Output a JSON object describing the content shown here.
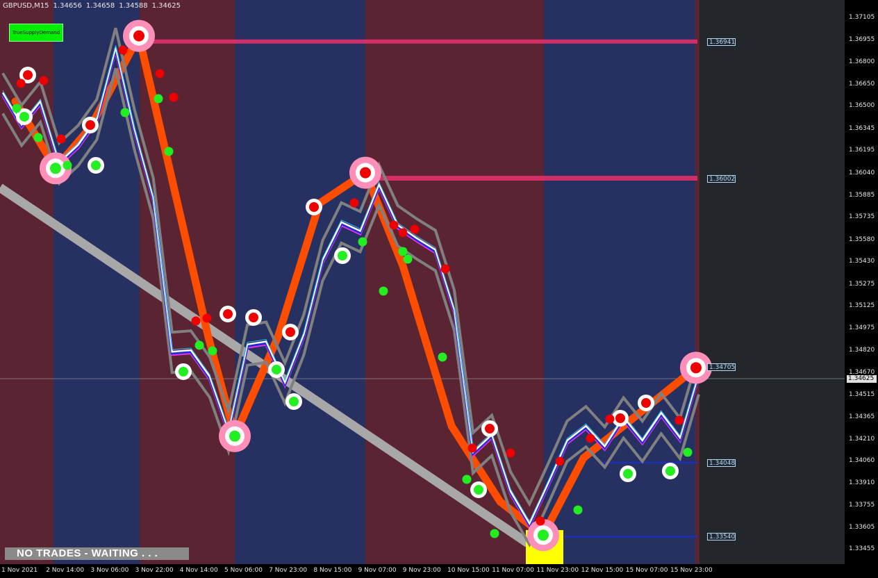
{
  "window": {
    "symbol": "GBPUSD,M15",
    "ohlc": [
      "1.34656",
      "1.34658",
      "1.34588",
      "1.34625"
    ]
  },
  "indicator_button": {
    "label": "TrueSupplyDemand"
  },
  "status_banner": {
    "text": "NO TRADES - WAITING . . ."
  },
  "price_axis": {
    "ticks": [
      "1.37105",
      "1.36955",
      "1.36800",
      "1.36650",
      "1.36500",
      "1.36345",
      "1.36195",
      "1.36040",
      "1.35885",
      "1.35735",
      "1.35580",
      "1.35430",
      "1.35275",
      "1.35125",
      "1.34975",
      "1.34820",
      "1.34670",
      "1.34515",
      "1.34365",
      "1.34210",
      "1.34060",
      "1.33910",
      "1.33755",
      "1.33605",
      "1.33455"
    ],
    "range": [
      1.3337,
      1.3715
    ]
  },
  "levels": [
    {
      "label": "1.36941",
      "value": 1.36941,
      "color": "#ff3f7f"
    },
    {
      "label": "1.36002",
      "value": 1.36002,
      "color": "#ff3f7f"
    },
    {
      "label": "1.34705",
      "value": 1.34705,
      "color": "#cccccc"
    },
    {
      "label": "1.34048",
      "value": 1.34048,
      "color": "#3333cc"
    },
    {
      "label": "1.33540",
      "value": 1.3354,
      "color": "#3333cc"
    }
  ],
  "current_price": {
    "label": "1.34625",
    "value": 1.34625
  },
  "time_axis": {
    "labels": [
      "1 Nov 2021",
      "2 Nov 14:00",
      "3 Nov 06:00",
      "3 Nov 22:00",
      "4 Nov 14:00",
      "5 Nov 06:00",
      "7 Nov 23:00",
      "8 Nov 15:00",
      "9 Nov 07:00",
      "9 Nov 23:00",
      "10 Nov 15:00",
      "11 Nov 07:00",
      "11 Nov 23:00",
      "12 Nov 15:00",
      "15 Nov 07:00",
      "15 Nov 23:00"
    ]
  },
  "colors": {
    "session_red": "#5a2432",
    "session_blue": "#273161",
    "zigzag": "#ff4d00",
    "swing_high": "#ee0000",
    "swing_low": "#22ee22",
    "ring_pink": "#ff8fb8",
    "ma_fast": "#ffffff",
    "ma_slow": "#1a2fd0",
    "ma_mid": "#ee30ee",
    "band": "#808080",
    "trend_line": "#a8a8a8",
    "yellow_box": "#ffff00"
  },
  "chart_data": {
    "type": "line",
    "y_range": [
      1.3337,
      1.3715
    ],
    "series": [
      {
        "name": "",
        "role": "zigzag",
        "values": [
          1.3653,
          1.3607,
          1.3635,
          1.3698,
          1.3491,
          1.3423,
          1.3491,
          1.3583,
          1.3604,
          1.354,
          1.343,
          1.3378,
          1.3355,
          1.3408,
          1.347
        ]
      },
      {
        "name": "",
        "role": "price",
        "values": [
          1.3659,
          1.3637,
          1.3653,
          1.3611,
          1.3623,
          1.3641,
          1.369,
          1.3634,
          1.3587,
          1.3481,
          1.3482,
          1.3464,
          1.3427,
          1.3486,
          1.3488,
          1.346,
          1.3493,
          1.3544,
          1.357,
          1.3564,
          1.3596,
          1.3568,
          1.3559,
          1.3551,
          1.351,
          1.3412,
          1.3424,
          1.3385,
          1.3363,
          1.3391,
          1.342,
          1.343,
          1.3416,
          1.3436,
          1.342,
          1.3439,
          1.3422,
          1.3466
        ]
      }
    ]
  }
}
